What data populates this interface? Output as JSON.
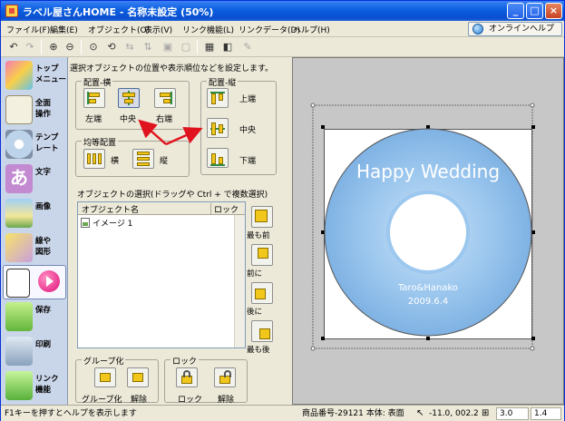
{
  "window": {
    "title": "ラベル屋さんHOME - 名称未設定 (50%)"
  },
  "menu": {
    "items": [
      "ファイル(F)",
      "編集(E)",
      "オブジェクト(O)",
      "表示(V)",
      "リンク機能(L)",
      "リンクデータ(D)",
      "ヘルプ(H)"
    ],
    "online_help": "オンラインヘルプ"
  },
  "sidebar": {
    "items": [
      {
        "label": "トップ\nメニュー",
        "icon": "home-icon"
      },
      {
        "label": "全面\n操作",
        "icon": "full-operation-icon"
      },
      {
        "label": "テンプ\nレート",
        "icon": "template-icon"
      },
      {
        "label": "文字",
        "icon": "text-icon"
      },
      {
        "label": "画像",
        "icon": "image-icon"
      },
      {
        "label": "線や\n図形",
        "icon": "shapes-icon"
      },
      {
        "label": "",
        "icon": "arrange-icon"
      },
      {
        "label": "保存",
        "icon": "save-icon"
      },
      {
        "label": "印刷",
        "icon": "print-icon"
      },
      {
        "label": "リンク\n機能",
        "icon": "link-icon"
      }
    ]
  },
  "panel": {
    "header": "選択オブジェクトの位置や表示順位などを設定します。",
    "align_h": {
      "title": "配置-横",
      "left": "左端",
      "center": "中央",
      "right": "右端"
    },
    "align_v": {
      "title": "配置-縦",
      "top": "上端",
      "middle": "中央",
      "bottom": "下端"
    },
    "distribute": {
      "title": "均等配置",
      "horizontal": "横",
      "vertical": "縦"
    },
    "select_label": "オブジェクトの選択(ドラッグや Ctrl + で複数選択)",
    "list_columns": [
      "オブジェクト名",
      "ロック"
    ],
    "list_rows": [
      "イメージ 1"
    ],
    "order": {
      "front": "最も前",
      "forward": "前に",
      "backward": "後に",
      "back": "最も後"
    },
    "group": {
      "title": "グループ化",
      "group": "グループ化",
      "ungroup": "解除"
    },
    "lock": {
      "title": "ロック",
      "lock": "ロック",
      "unlock": "解除"
    }
  },
  "canvas": {
    "cd_title": "Happy Wedding",
    "cd_names": "Taro&Hanako",
    "cd_date": "2009.6.4",
    "accent_blue": "#9cc7ee"
  },
  "status": {
    "hint": "F1キーを押すとヘルプを表示します",
    "product": "商品番号-29121 本体: 表面",
    "coords": "-11.0, 002.2",
    "width": "3.0",
    "height": "1.4"
  }
}
